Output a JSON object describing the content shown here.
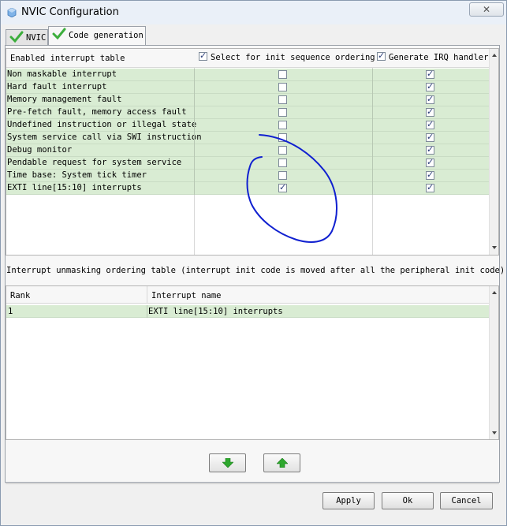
{
  "window": {
    "title": "NVIC Configuration",
    "close_symbol": "✕"
  },
  "tabs": [
    {
      "label": "NVIC",
      "active": false
    },
    {
      "label": "Code generation",
      "active": true
    }
  ],
  "interrupt_table": {
    "header": {
      "col1": "Enabled interrupt table",
      "col2": "Select for init sequence ordering",
      "col2_checked": true,
      "col3": "Generate IRQ handler",
      "col3_checked": true
    },
    "rows": [
      {
        "name": "Non maskable interrupt",
        "init_order": false,
        "irq_handler": true
      },
      {
        "name": "Hard fault interrupt",
        "init_order": false,
        "irq_handler": true
      },
      {
        "name": "Memory management fault",
        "init_order": false,
        "irq_handler": true
      },
      {
        "name": "Pre-fetch fault, memory access fault",
        "init_order": false,
        "irq_handler": true
      },
      {
        "name": "Undefined instruction or illegal state",
        "init_order": false,
        "irq_handler": true
      },
      {
        "name": "System service call via SWI instruction",
        "init_order": false,
        "irq_handler": true
      },
      {
        "name": "Debug monitor",
        "init_order": false,
        "irq_handler": true
      },
      {
        "name": "Pendable request for system service",
        "init_order": false,
        "irq_handler": true
      },
      {
        "name": "Time base: System tick timer",
        "init_order": false,
        "irq_handler": true
      },
      {
        "name": "EXTI line[15:10] interrupts",
        "init_order": true,
        "irq_handler": true
      }
    ]
  },
  "ordering_table": {
    "caption": "Interrupt unmasking ordering table (interrupt init code is moved after all the peripheral init code)",
    "headers": {
      "rank": "Rank",
      "name": "Interrupt name"
    },
    "rows": [
      {
        "rank": "1",
        "name": "EXTI line[15:10] interrupts"
      }
    ]
  },
  "buttons": {
    "apply": "Apply",
    "ok": "Ok",
    "cancel": "Cancel"
  },
  "colors": {
    "row_highlight": "#d9ecd3",
    "annotation_ink": "#1020d0",
    "move_arrow": "#2ea82e"
  }
}
